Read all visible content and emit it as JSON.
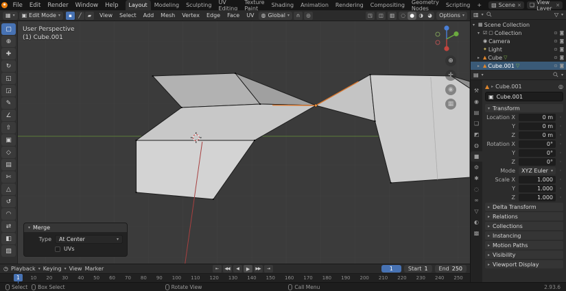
{
  "icons": {
    "dropdown": "▾",
    "collapsed": "▸",
    "expanded": "▾",
    "close": "✕",
    "editor_viewport": "▦",
    "editor_outliner": "▥",
    "editor_properties": "▤",
    "editor_timeline": "◷",
    "mode_cube": "▣",
    "vertex_select": "▪",
    "edge_select": "╱",
    "face_select": "▰",
    "orientation_globe": "◍",
    "snap_magnet": "∩",
    "proportional_circle": "◎",
    "gizmo_toggle": "◳",
    "overlays_toggle": "◫",
    "xray_toggle": "▥",
    "shade_wireframe": "◌",
    "shade_solid": "●",
    "shade_material": "◑",
    "shade_rendered": "◕",
    "scene": "▧",
    "view_layer": "❏",
    "funnel": "▽",
    "pin": "◎",
    "eye": "⊙",
    "camera_render": "◙",
    "checkbox": "☑",
    "scene_collection": "▦",
    "collection": "▢",
    "camera_object": "◉",
    "light_object": "✦",
    "mesh_object": "▲",
    "mesh_data": "▽",
    "edit_dot": "·",
    "vp_zoom": "⊕",
    "vp_pan": "✛",
    "vp_camera": "◉",
    "vp_ortho": "▦",
    "keyframe_dot": "◦"
  },
  "topbar": {
    "menus": [
      "File",
      "Edit",
      "Render",
      "Window",
      "Help"
    ],
    "tabs": [
      "Layout",
      "Modeling",
      "Sculpting",
      "UV Editing",
      "Texture Paint",
      "Shading",
      "Animation",
      "Rendering",
      "Compositing",
      "Geometry Nodes",
      "Scripting"
    ],
    "new_tab": "+",
    "scene_label": "Scene",
    "view_layer_label": "View Layer"
  },
  "viewport_header": {
    "mode": "Edit Mode",
    "menus": [
      "View",
      "Select",
      "Add",
      "Mesh",
      "Vertex",
      "Edge",
      "Face",
      "UV"
    ],
    "orientation": "Global",
    "options": "Options"
  },
  "tools": [
    {
      "name": "select-box",
      "glyph": "▢"
    },
    {
      "name": "cursor",
      "glyph": "⊕"
    },
    {
      "name": "move",
      "glyph": "✚"
    },
    {
      "name": "rotate",
      "glyph": "↻"
    },
    {
      "name": "scale",
      "glyph": "◱"
    },
    {
      "name": "transform",
      "glyph": "◲"
    },
    {
      "name": "annotate",
      "glyph": "✎"
    },
    {
      "name": "measure",
      "glyph": "∠"
    },
    {
      "name": "extrude-region",
      "glyph": "⇧"
    },
    {
      "name": "inset-faces",
      "glyph": "▣"
    },
    {
      "name": "bevel",
      "glyph": "◇"
    },
    {
      "name": "loop-cut",
      "glyph": "▤"
    },
    {
      "name": "knife",
      "glyph": "✄"
    },
    {
      "name": "poly-build",
      "glyph": "△"
    },
    {
      "name": "spin",
      "glyph": "↺"
    },
    {
      "name": "smooth",
      "glyph": "◠"
    },
    {
      "name": "edge-slide",
      "glyph": "⇄"
    },
    {
      "name": "shrink-fatten",
      "glyph": "◧"
    },
    {
      "name": "shear",
      "glyph": "▨"
    }
  ],
  "viewport": {
    "overlay_line1": "User Perspective",
    "overlay_line2": "(1) Cube.001"
  },
  "merge_panel": {
    "title": "Merge",
    "type_label": "Type",
    "type_value": "At Center",
    "uvs_label": "UVs"
  },
  "timeline": {
    "menus": [
      "Playback",
      "Keying",
      "View",
      "Marker"
    ],
    "transport": [
      {
        "name": "jump-to-start",
        "glyph": "⇤"
      },
      {
        "name": "prev-keyframe",
        "glyph": "◀◀"
      },
      {
        "name": "play-reverse",
        "glyph": "◀"
      },
      {
        "name": "play",
        "glyph": "▶"
      },
      {
        "name": "next-keyframe",
        "glyph": "▶▶"
      },
      {
        "name": "jump-to-end",
        "glyph": "⇥"
      }
    ],
    "current_frame": "1",
    "start_label": "Start",
    "start_value": "1",
    "end_label": "End",
    "end_value": "250",
    "ticks": [
      "1",
      "10",
      "20",
      "30",
      "40",
      "50",
      "60",
      "70",
      "80",
      "90",
      "100",
      "110",
      "120",
      "130",
      "140",
      "150",
      "160",
      "170",
      "180",
      "190",
      "200",
      "210",
      "220",
      "230",
      "240",
      "250"
    ]
  },
  "statusbar": {
    "select": "Select",
    "box_select": "Box Select",
    "rotate_view": "Rotate View",
    "call_menu": "Call Menu",
    "version": "2.93.6"
  },
  "outliner": {
    "rows": [
      {
        "label": "Scene Collection"
      },
      {
        "label": "Collection"
      },
      {
        "label": "Camera"
      },
      {
        "label": "Light"
      },
      {
        "label": "Cube"
      },
      {
        "label": "Cube.001"
      }
    ]
  },
  "properties": {
    "breadcrumb": "Cube.001",
    "name": "Cube.001",
    "transform_title": "Transform",
    "rows": [
      {
        "label": "Location X",
        "value": "0 m"
      },
      {
        "label": "Y",
        "value": "0 m"
      },
      {
        "label": "Z",
        "value": "0 m"
      },
      {
        "label": "Rotation X",
        "value": "0°"
      },
      {
        "label": "Y",
        "value": "0°"
      },
      {
        "label": "Z",
        "value": "0°"
      },
      {
        "label": "Mode",
        "value": "XYZ Euler"
      },
      {
        "label": "Scale X",
        "value": "1.000"
      },
      {
        "label": "Y",
        "value": "1.000"
      },
      {
        "label": "Z",
        "value": "1.000"
      }
    ],
    "sections": [
      "Delta Transform",
      "Relations",
      "Collections",
      "Instancing",
      "Motion Paths",
      "Visibility",
      "Viewport Display"
    ],
    "tabs": [
      {
        "name": "tool",
        "glyph": "⚒"
      },
      {
        "name": "render",
        "glyph": "◉"
      },
      {
        "name": "output",
        "glyph": "▤"
      },
      {
        "name": "view-layer",
        "glyph": "❏"
      },
      {
        "name": "scene",
        "glyph": "◩"
      },
      {
        "name": "world",
        "glyph": "◍"
      },
      {
        "name": "object",
        "glyph": "■"
      },
      {
        "name": "modifiers",
        "glyph": "⚙"
      },
      {
        "name": "particles",
        "glyph": "✱"
      },
      {
        "name": "physics",
        "glyph": "◌"
      },
      {
        "name": "constraints",
        "glyph": "∞"
      },
      {
        "name": "object-data",
        "glyph": "▽"
      },
      {
        "name": "material",
        "glyph": "◐"
      },
      {
        "name": "texture",
        "glyph": "▩"
      }
    ]
  }
}
